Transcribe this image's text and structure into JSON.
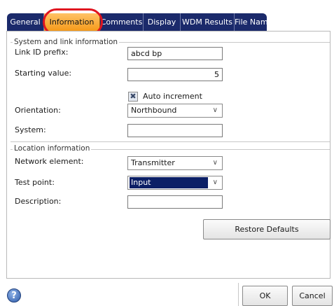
{
  "tabs": [
    {
      "label": "General",
      "active": false
    },
    {
      "label": "Information",
      "active": true
    },
    {
      "label": "Comments",
      "active": false
    },
    {
      "label": "Display",
      "active": false
    },
    {
      "label": "WDM Results",
      "active": false
    },
    {
      "label": "File Name",
      "active": false
    }
  ],
  "system_group": {
    "title": "System and link information",
    "link_id_prefix_label": "Link ID prefix:",
    "link_id_prefix_value": "abcd bp",
    "starting_value_label": "Starting value:",
    "starting_value": "5",
    "auto_increment_label": "Auto increment",
    "auto_increment_checked": true,
    "orientation_label": "Orientation:",
    "orientation_value": "Northbound",
    "system_label": "System:",
    "system_value": ""
  },
  "location_group": {
    "title": "Location information",
    "network_element_label": "Network element:",
    "network_element_value": "Transmitter",
    "test_point_label": "Test point:",
    "test_point_value": "Input",
    "description_label": "Description:",
    "description_value": ""
  },
  "buttons": {
    "restore_defaults": "Restore Defaults",
    "ok": "OK",
    "cancel": "Cancel",
    "help": "?"
  },
  "colors": {
    "tab_bar": "#1b2a6b",
    "active_tab": "#f59a1a",
    "highlight_ring": "#e0141f",
    "selected_combo": "#0b1f66"
  }
}
